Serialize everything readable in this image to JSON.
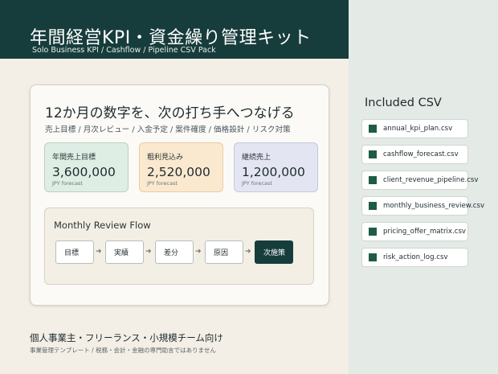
{
  "header": {
    "title": "年間経営KPI・資金繰り管理キット",
    "subtitle": "Solo Business KPI / Cashflow / Pipeline CSV Pack",
    "background_color": "#173c3c"
  },
  "main": {
    "headline": "12か月の数字を、次の打ち手へつなげる",
    "keywords": "売上目標 / 月次レビュー / 入金予定 / 案件確度 / 価格設計 / リスク対策",
    "kpis": [
      {
        "label": "年間売上目標",
        "value": "3,600,000",
        "unit": "JPY forecast",
        "color": "#dfeee4"
      },
      {
        "label": "粗利見込み",
        "value": "2,520,000",
        "unit": "JPY forecast",
        "color": "#fbe9cf"
      },
      {
        "label": "継続売上",
        "value": "1,200,000",
        "unit": "JPY forecast",
        "color": "#e3e6f2"
      }
    ],
    "flow": {
      "title": "Monthly Review Flow",
      "steps": [
        "目標",
        "実績",
        "差分",
        "原因",
        "次施策"
      ],
      "arrow": "➜",
      "active_color": "#173c3c"
    }
  },
  "sidebar": {
    "title": "Included CSV",
    "files": [
      "annual_kpi_plan.csv",
      "cashflow_forecast.csv",
      "client_revenue_pipeline.csv",
      "monthly_business_review.csv",
      "pricing_offer_matrix.csv",
      "risk_action_log.csv"
    ],
    "file_icon": "csv-file-icon",
    "icon_color": "#1f5c44"
  },
  "footer": {
    "main": "個人事業主・フリーランス・小規模チーム向け",
    "sub": "事業管理テンプレート / 税務・会計・金融の専門助言ではありません"
  }
}
